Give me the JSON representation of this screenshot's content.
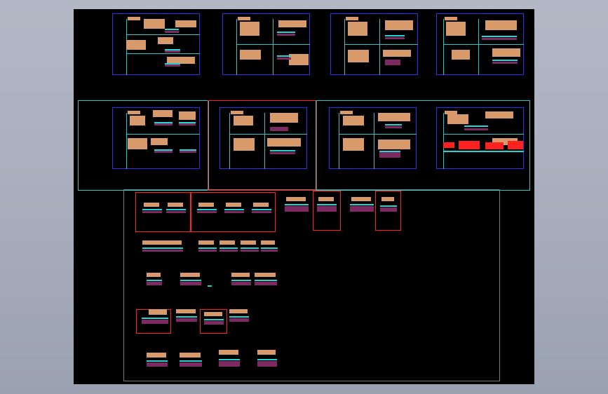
{
  "app": {
    "viewport": "drawing-canvas"
  },
  "colors": {
    "background": "#000000",
    "window_bg": "#aab0bf",
    "dimension_line": "#2a2ff0",
    "section_line": "#1ec8c8",
    "annotation_text": "#d89a6a",
    "highlight_box": "#ff2020",
    "group_box": "#22c9c9",
    "material_fill": "#7d2a63"
  },
  "sheets": {
    "row1": [
      "sheet-1",
      "sheet-2",
      "sheet-3",
      "sheet-4"
    ],
    "row2": [
      "sheet-5",
      "sheet-6",
      "sheet-7",
      "sheet-8"
    ]
  },
  "detail_groups": {
    "rows": 5
  }
}
